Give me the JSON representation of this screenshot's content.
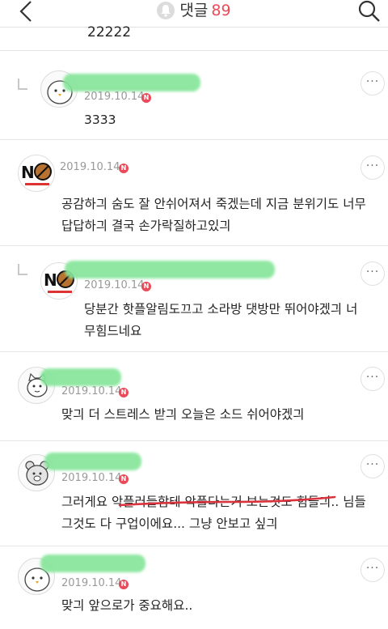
{
  "header": {
    "title": "댓글",
    "count": "89"
  },
  "top_partial_text": "22222",
  "comments": [
    {
      "date": "2019.10.14",
      "badge": "N",
      "text": "3333",
      "avatar": "chick-avatar",
      "reply": true
    },
    {
      "date": "2019.10.14",
      "badge": "N",
      "text_lines": [
        "공감하긔 숨도 잘 안쉬어져서 죽겠는데 지금 분위기도 너무",
        "답답하긔 결국 손가락질하고있긔"
      ],
      "avatar": "no-food-avatar",
      "reply": false
    },
    {
      "date": "2019.10.14",
      "badge": "N",
      "text_lines": [
        "당분간 핫플알림도끄고 소라방 댓방만 뛰어야겠긔 너",
        "무힘드네요"
      ],
      "avatar": "no-food-avatar",
      "reply": true
    },
    {
      "date": "2019.10.14",
      "badge": "N",
      "text_lines": [
        "맞긔 더 스트레스 받긔 오늘은 소드 쉬어야겠긔"
      ],
      "avatar": "cat-avatar",
      "reply": false
    },
    {
      "date": "2019.10.14",
      "badge": "N",
      "text_lines": [
        "그러게요 악플러들함테 악플다는거 보는것도 힘들긔.. 님들",
        "그것도 다 구업이에요... 그냥 안보고 싶긔"
      ],
      "avatar": "bear-avatar",
      "reply": false
    },
    {
      "date": "2019.10.14",
      "badge": "N",
      "text_lines": [
        "맞긔 앞으로가 중요해요.."
      ],
      "avatar": "chick-avatar",
      "reply": false
    }
  ],
  "more_label": "···",
  "colors": {
    "accent": "#e94b5b",
    "redaction": "#86e59a",
    "underline": "#d9333d"
  }
}
